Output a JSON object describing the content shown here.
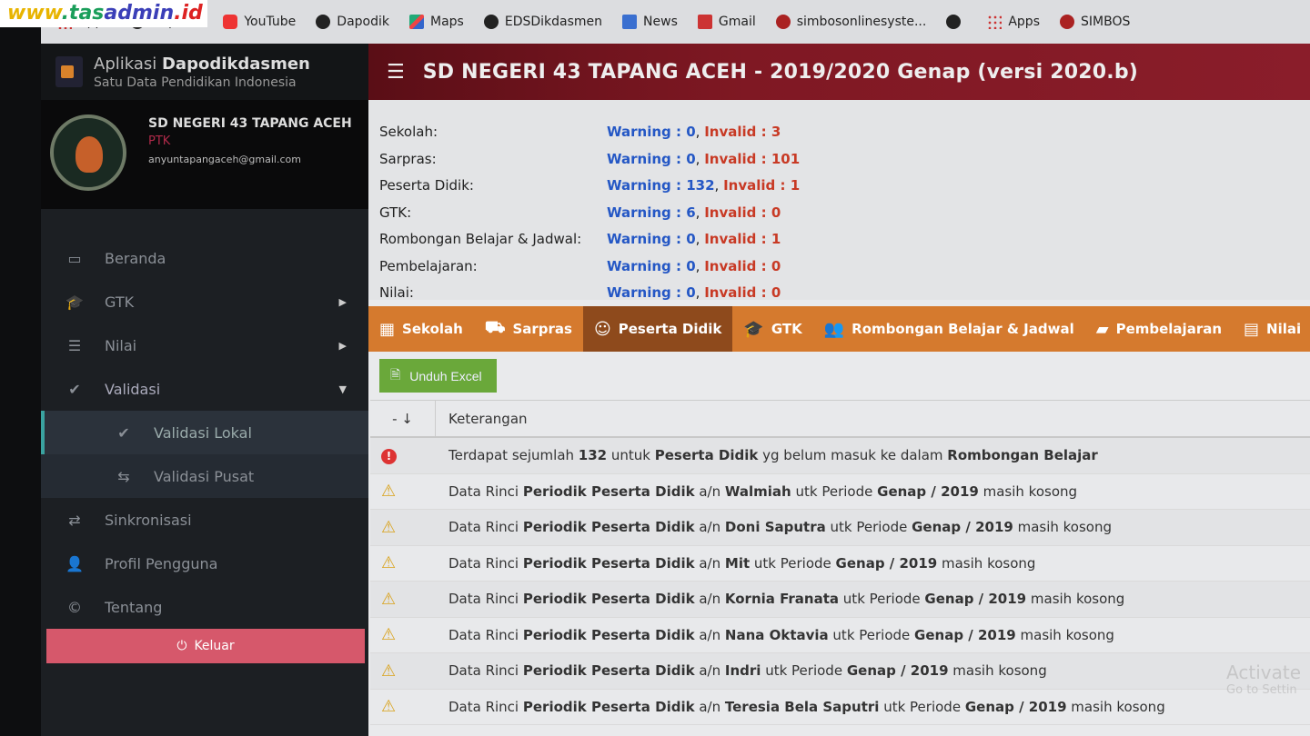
{
  "watermark": {
    "p1": "www",
    "p2": ".tas",
    "p3": "admin",
    "p4": ".id"
  },
  "bookmarks": [
    {
      "label": "Apps",
      "icon": "apps-icon"
    },
    {
      "label": "Dapodik",
      "icon": "dapodik-icon"
    },
    {
      "label": "YouTube",
      "icon": "youtube-icon"
    },
    {
      "label": "Dapodik",
      "icon": "dapodik-icon"
    },
    {
      "label": "Maps",
      "icon": "maps-icon"
    },
    {
      "label": "EDSDikdasmen",
      "icon": "eds-icon"
    },
    {
      "label": "News",
      "icon": "news-icon"
    },
    {
      "label": "Gmail",
      "icon": "gmail-icon"
    },
    {
      "label": "simbosonlinesyste...",
      "icon": "simbos-icon"
    },
    {
      "label": "",
      "icon": "globe-icon"
    },
    {
      "label": "Apps",
      "icon": "apps-icon"
    },
    {
      "label": "SIMBOS",
      "icon": "simbos-icon"
    }
  ],
  "brand": {
    "prefix": "Aplikasi ",
    "name": "Dapodikdasmen",
    "subtitle": "Satu Data Pendidikan Indonesia"
  },
  "profile": {
    "name": "SD NEGERI 43 TAPANG ACEH",
    "role": "PTK",
    "email": "anyuntapangaceh@gmail.com"
  },
  "menu": {
    "beranda": "Beranda",
    "gtk": "GTK",
    "nilai": "Nilai",
    "validasi": "Validasi",
    "validasi_lokal": "Validasi Lokal",
    "validasi_pusat": "Validasi Pusat",
    "sinkronisasi": "Sinkronisasi",
    "profil": "Profil Pengguna",
    "tentang": "Tentang",
    "keluar": "Keluar"
  },
  "header": {
    "title": "SD NEGERI 43 TAPANG ACEH - 2019/2020 Genap (versi 2020.b)"
  },
  "summary": [
    {
      "label": "Sekolah:",
      "warning": "Warning : 0",
      "invalid": "Invalid : 3"
    },
    {
      "label": "Sarpras:",
      "warning": "Warning : 0",
      "invalid": "Invalid : 101"
    },
    {
      "label": "Peserta Didik:",
      "warning": "Warning : 132",
      "invalid": "Invalid : 1"
    },
    {
      "label": "GTK:",
      "warning": "Warning : 6",
      "invalid": "Invalid : 0"
    },
    {
      "label": "Rombongan Belajar & Jadwal:",
      "warning": "Warning : 0",
      "invalid": "Invalid : 1"
    },
    {
      "label": "Pembelajaran:",
      "warning": "Warning : 0",
      "invalid": "Invalid : 0"
    },
    {
      "label": "Nilai:",
      "warning": "Warning : 0",
      "invalid": "Invalid : 0"
    }
  ],
  "tabs": [
    {
      "label": "Sekolah",
      "icon": "▦"
    },
    {
      "label": "Sarpras",
      "icon": "⛟"
    },
    {
      "label": "Peserta Didik",
      "icon": "☺",
      "active": true
    },
    {
      "label": "GTK",
      "icon": "🎓"
    },
    {
      "label": "Rombongan Belajar & Jadwal",
      "icon": "👥"
    },
    {
      "label": "Pembelajaran",
      "icon": "▰"
    },
    {
      "label": "Nilai",
      "icon": "▤"
    }
  ],
  "toolbar": {
    "excel": "Unduh Excel"
  },
  "table": {
    "col1": "- ↓",
    "col2": "Keterangan",
    "rows": [
      {
        "type": "error",
        "parts": [
          [
            "Terdapat sejumlah ",
            0
          ],
          [
            "132",
            1
          ],
          [
            " untuk ",
            0
          ],
          [
            "Peserta Didik",
            1
          ],
          [
            " yg belum masuk ke dalam ",
            0
          ],
          [
            "Rombongan Belajar",
            1
          ]
        ]
      },
      {
        "type": "warning",
        "parts": [
          [
            "Data Rinci ",
            0
          ],
          [
            "Periodik Peserta Didik",
            1
          ],
          [
            " a/n ",
            0
          ],
          [
            "Walmiah",
            1
          ],
          [
            " utk Periode ",
            0
          ],
          [
            "Genap / 2019",
            1
          ],
          [
            " masih kosong",
            0
          ]
        ]
      },
      {
        "type": "warning",
        "parts": [
          [
            "Data Rinci ",
            0
          ],
          [
            "Periodik Peserta Didik",
            1
          ],
          [
            " a/n ",
            0
          ],
          [
            "Doni Saputra",
            1
          ],
          [
            " utk Periode ",
            0
          ],
          [
            "Genap / 2019",
            1
          ],
          [
            " masih kosong",
            0
          ]
        ]
      },
      {
        "type": "warning",
        "parts": [
          [
            "Data Rinci ",
            0
          ],
          [
            "Periodik Peserta Didik",
            1
          ],
          [
            " a/n ",
            0
          ],
          [
            "Mit",
            1
          ],
          [
            " utk Periode ",
            0
          ],
          [
            "Genap / 2019",
            1
          ],
          [
            " masih kosong",
            0
          ]
        ]
      },
      {
        "type": "warning",
        "parts": [
          [
            "Data Rinci ",
            0
          ],
          [
            "Periodik Peserta Didik",
            1
          ],
          [
            " a/n ",
            0
          ],
          [
            "Kornia Franata",
            1
          ],
          [
            " utk Periode ",
            0
          ],
          [
            "Genap / 2019",
            1
          ],
          [
            " masih kosong",
            0
          ]
        ]
      },
      {
        "type": "warning",
        "parts": [
          [
            "Data Rinci ",
            0
          ],
          [
            "Periodik Peserta Didik",
            1
          ],
          [
            " a/n ",
            0
          ],
          [
            "Nana Oktavia",
            1
          ],
          [
            " utk Periode ",
            0
          ],
          [
            "Genap / 2019",
            1
          ],
          [
            " masih kosong",
            0
          ]
        ]
      },
      {
        "type": "warning",
        "parts": [
          [
            "Data Rinci ",
            0
          ],
          [
            "Periodik Peserta Didik",
            1
          ],
          [
            " a/n ",
            0
          ],
          [
            "Indri",
            1
          ],
          [
            " utk Periode ",
            0
          ],
          [
            "Genap / 2019",
            1
          ],
          [
            " masih kosong",
            0
          ]
        ]
      },
      {
        "type": "warning",
        "parts": [
          [
            "Data Rinci ",
            0
          ],
          [
            "Periodik Peserta Didik",
            1
          ],
          [
            " a/n ",
            0
          ],
          [
            "Teresia Bela Saputri",
            1
          ],
          [
            " utk Periode ",
            0
          ],
          [
            "Genap / 2019",
            1
          ],
          [
            " masih kosong",
            0
          ]
        ]
      }
    ]
  },
  "overlay": {
    "activate": "Activate",
    "activate_sub": "Go to Settin"
  },
  "colors": {
    "header": "#7f1823",
    "tabs": "#d57a2e",
    "tab_active": "#8e4a1c",
    "warning": "#2457c5",
    "invalid": "#c83a25",
    "excel": "#6aa83a",
    "logout": "#d6586b"
  }
}
